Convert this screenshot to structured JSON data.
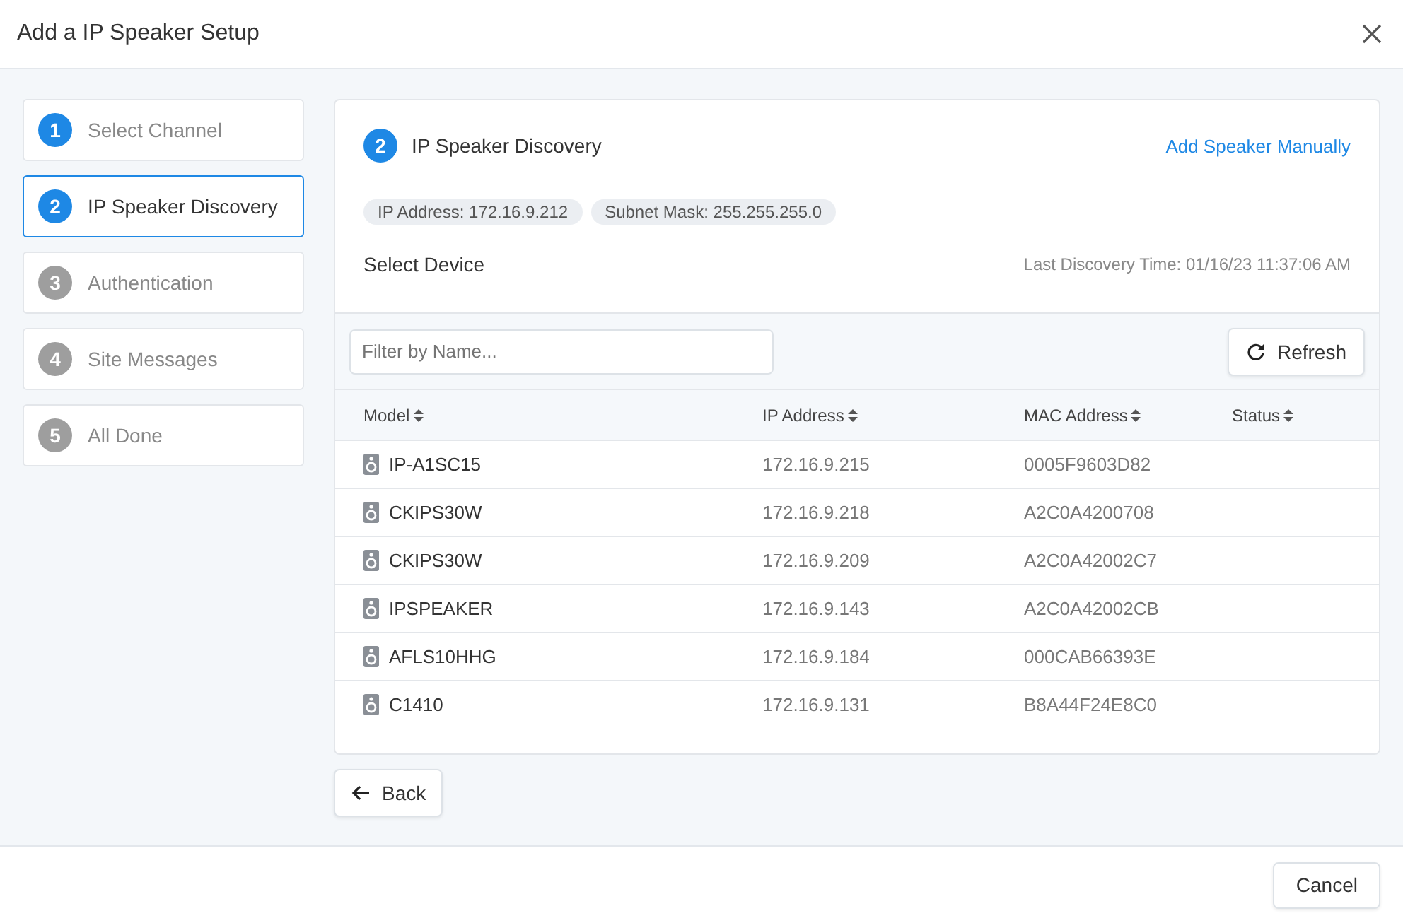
{
  "window": {
    "title": "Add a IP Speaker Setup"
  },
  "steps": [
    {
      "number": "1",
      "label": "Select Channel",
      "completed": true,
      "selected": false
    },
    {
      "number": "2",
      "label": "IP Speaker Discovery",
      "completed": true,
      "selected": true
    },
    {
      "number": "3",
      "label": "Authentication",
      "completed": false,
      "selected": false
    },
    {
      "number": "4",
      "label": "Site Messages",
      "completed": false,
      "selected": false
    },
    {
      "number": "5",
      "label": "All Done",
      "completed": false,
      "selected": false
    }
  ],
  "panel": {
    "step_number": "2",
    "title": "IP Speaker Discovery",
    "link": "Add Speaker Manually",
    "chips": [
      "IP Address: 172.16.9.212",
      "Subnet Mask: 255.255.255.0"
    ],
    "subtitle": "Select Device",
    "last_discovery": "Last Discovery Time: 01/16/23 11:37:06 AM"
  },
  "filter": {
    "placeholder": "Filter by Name..."
  },
  "refresh_button": "Refresh",
  "table": {
    "columns": [
      "Model",
      "IP Address",
      "MAC Address",
      "Status"
    ],
    "rows": [
      [
        "IP-A1SC15",
        "172.16.9.215",
        "0005F9603D82"
      ],
      [
        "CKIPS30W",
        "172.16.9.218",
        "A2C0A4200708"
      ],
      [
        "CKIPS30W",
        "172.16.9.209",
        "A2C0A42002C7"
      ],
      [
        "IPSPEAKER",
        "172.16.9.143",
        "A2C0A42002CB"
      ],
      [
        "AFLS10HHG",
        "172.16.9.184",
        "000CAB66393E"
      ],
      [
        "C1410",
        "172.16.9.131",
        "B8A44F24E8C0"
      ]
    ]
  },
  "back_button": "Back",
  "cancel_button": "Cancel"
}
